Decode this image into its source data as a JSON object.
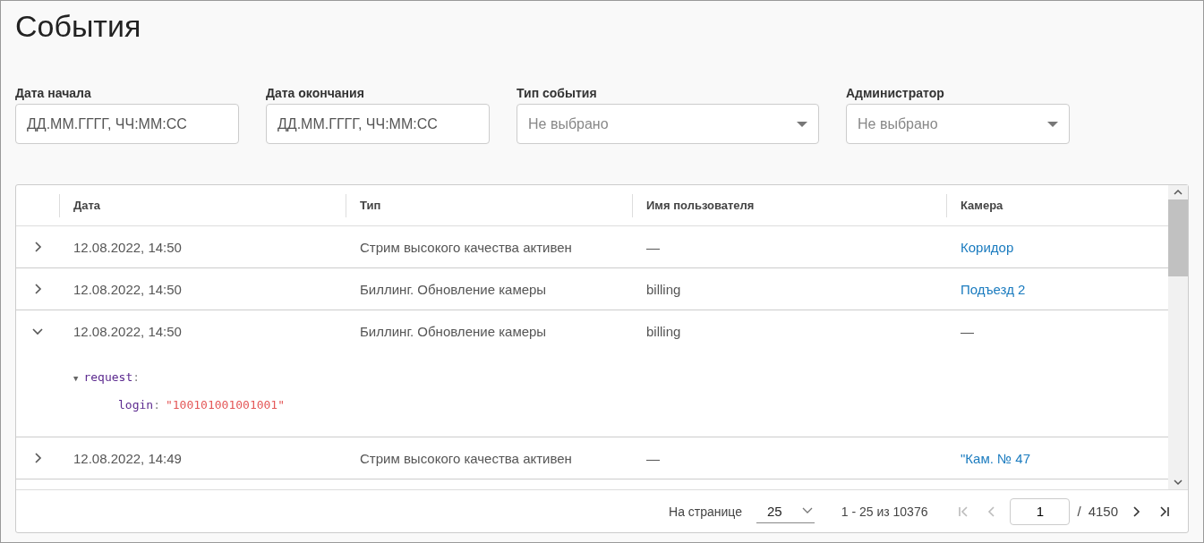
{
  "title": "События",
  "filters": [
    {
      "label": "Дата начала",
      "kind": "input",
      "placeholder": "ДД.ММ.ГГГГ, ЧЧ:ММ:СС"
    },
    {
      "label": "Дата окончания",
      "kind": "input",
      "placeholder": "ДД.ММ.ГГГГ, ЧЧ:ММ:СС"
    },
    {
      "label": "Тип события",
      "kind": "select",
      "placeholder": "Не выбрано"
    },
    {
      "label": "Администратор",
      "kind": "select",
      "placeholder": "Не выбрано"
    }
  ],
  "table": {
    "columns": [
      "Дата",
      "Тип",
      "Имя пользователя",
      "Камера"
    ],
    "rows": [
      {
        "expanded": false,
        "date": "12.08.2022, 14:50",
        "type": "Стрим высокого качества активен",
        "user": "—",
        "camera": {
          "kind": "link",
          "text": "Коридор"
        }
      },
      {
        "expanded": false,
        "date": "12.08.2022, 14:50",
        "type": "Биллинг. Обновление камеры",
        "user": "billing",
        "camera": {
          "kind": "link",
          "text": "Подъезд 2"
        }
      },
      {
        "expanded": true,
        "date": "12.08.2022, 14:50",
        "type": "Биллинг. Обновление камеры",
        "user": "billing",
        "camera": {
          "kind": "text",
          "text": "—"
        },
        "details": {
          "toggle": "▼",
          "key": "request",
          "colon": ":",
          "children": [
            {
              "key": "login",
              "colon": ":",
              "value": "\"100101001001001\""
            }
          ]
        }
      },
      {
        "expanded": false,
        "date": "12.08.2022, 14:49",
        "type": "Стрим высокого качества активен",
        "user": "—",
        "camera": {
          "kind": "link",
          "text": "\"Кам. № 47"
        }
      }
    ]
  },
  "pagination": {
    "per_page_label": "На странице",
    "per_page": "25",
    "range": "1 - 25 из 10376",
    "page": "1",
    "separator": "/",
    "total_pages": "4150",
    "buttons": [
      {
        "kind": "first",
        "disabled": true
      },
      {
        "kind": "prev",
        "disabled": true
      },
      {
        "kind": "next",
        "disabled": false
      },
      {
        "kind": "last",
        "disabled": false
      }
    ]
  }
}
